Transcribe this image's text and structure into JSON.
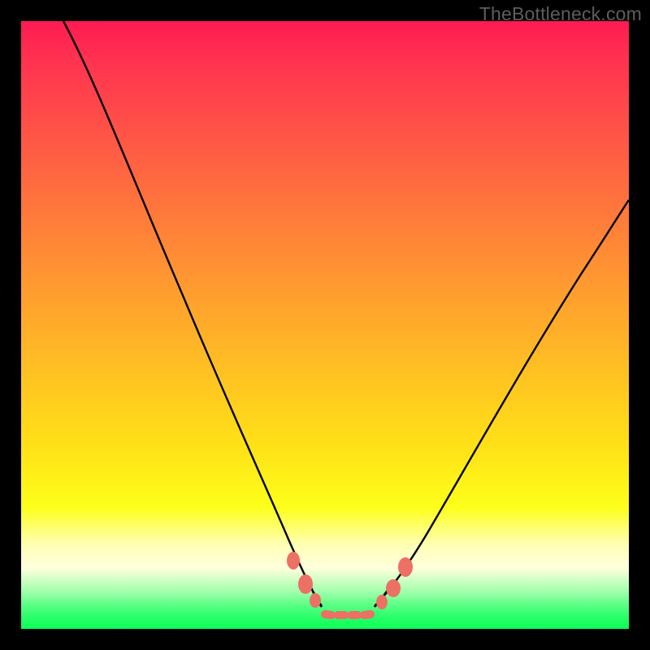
{
  "watermark": "TheBottleneck.com",
  "chart_data": {
    "type": "line",
    "title": "",
    "xlabel": "",
    "ylabel": "",
    "xlim": [
      0,
      100
    ],
    "ylim": [
      0,
      100
    ],
    "grid": false,
    "legend": false,
    "series": [
      {
        "name": "bottleneck-curve",
        "x": [
          7,
          10,
          15,
          20,
          25,
          30,
          35,
          40,
          44,
          47,
          49,
          51,
          53,
          55,
          57,
          61,
          65,
          70,
          75,
          80,
          85,
          90,
          95,
          100
        ],
        "y": [
          100,
          92,
          80,
          68,
          56,
          45,
          34,
          23,
          13,
          7,
          3.5,
          2.2,
          2,
          2,
          2.2,
          4,
          8,
          15,
          22,
          30,
          38,
          46,
          54,
          62
        ]
      }
    ],
    "optimum_band": {
      "x_start": 49,
      "x_end": 58
    },
    "marker_clusters": [
      {
        "cx": 44.5,
        "cy": 11,
        "r": 1.5
      },
      {
        "cx": 46.5,
        "cy": 7,
        "r": 1.7
      },
      {
        "cx": 48,
        "cy": 4.5,
        "r": 1.4
      },
      {
        "cx": 50,
        "cy": 2.5,
        "r": 1.6
      },
      {
        "cx": 52.5,
        "cy": 2.0,
        "r": 1.6
      },
      {
        "cx": 55,
        "cy": 2.0,
        "r": 1.6
      },
      {
        "cx": 57.5,
        "cy": 2.3,
        "r": 1.6
      },
      {
        "cx": 59.5,
        "cy": 3.5,
        "r": 1.4
      },
      {
        "cx": 61.5,
        "cy": 5.5,
        "r": 1.6
      },
      {
        "cx": 63.5,
        "cy": 9,
        "r": 1.7
      }
    ],
    "dotted_segment_range": {
      "x_start": 49,
      "x_end": 58
    },
    "colors": {
      "curve": "#000000",
      "markers": "#ec7063",
      "gradient_top": "#ff1a52",
      "gradient_bottom": "#0bff56",
      "frame": "#000000"
    }
  }
}
